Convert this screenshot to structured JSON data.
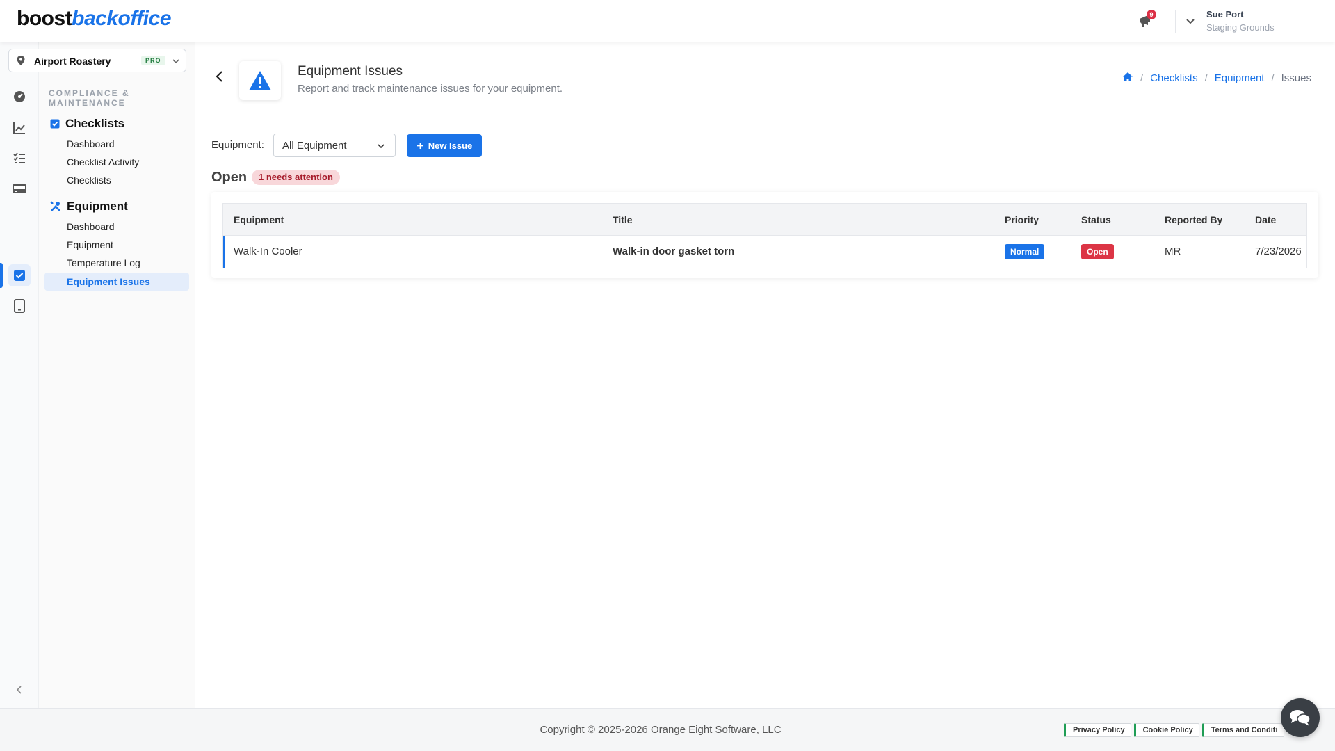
{
  "app": {
    "logo_part1": "boost",
    "logo_part2": "backoffice",
    "notification_count": "9",
    "user_name": "Sue Port",
    "user_org": "Staging Grounds"
  },
  "location": {
    "name": "Airport Roastery",
    "plan_badge": "PRO"
  },
  "sidebar": {
    "section_label": "COMPLIANCE & MAINTENANCE",
    "groups": [
      {
        "label": "Checklists",
        "icon": "checkbox-icon",
        "items": [
          {
            "label": "Dashboard"
          },
          {
            "label": "Checklist Activity"
          },
          {
            "label": "Checklists"
          }
        ]
      },
      {
        "label": "Equipment",
        "icon": "tools-icon",
        "items": [
          {
            "label": "Dashboard"
          },
          {
            "label": "Equipment"
          },
          {
            "label": "Temperature Log"
          },
          {
            "label": "Equipment Issues",
            "active": true
          }
        ]
      }
    ]
  },
  "rail": {
    "icons": [
      "gauge-icon",
      "chart-line-icon",
      "list-check-icon",
      "register-icon",
      "checkbox-icon",
      "tablet-icon"
    ],
    "active": "checkbox-icon"
  },
  "page": {
    "title": "Equipment Issues",
    "subtitle": "Report and track maintenance issues for your equipment.",
    "header_icon": "warning-icon",
    "breadcrumb": {
      "home": "home-icon",
      "items": [
        "Checklists",
        "Equipment"
      ],
      "current": "Issues"
    }
  },
  "filter": {
    "label": "Equipment:",
    "selected": "All Equipment",
    "new_issue_label": "New Issue"
  },
  "open_section": {
    "title": "Open",
    "badge": "1 needs attention"
  },
  "table": {
    "columns": [
      "Equipment",
      "Title",
      "Priority",
      "Status",
      "Reported By",
      "Date"
    ],
    "rows": [
      {
        "equipment": "Walk-In Cooler",
        "title": "Walk-in door gasket torn",
        "priority": "Normal",
        "status": "Open",
        "reported_by": "MR",
        "date": "7/23/2026"
      }
    ]
  },
  "footer": {
    "copyright": "Copyright © 2025-2026 Orange Eight Software, LLC",
    "links": [
      "Privacy Policy",
      "Cookie Policy",
      "Terms and Conditi"
    ]
  },
  "colors": {
    "accent": "#1a73e8",
    "danger": "#dc3545",
    "attention_bg": "#f8d7da",
    "pro_bg": "#e8f6ec"
  }
}
